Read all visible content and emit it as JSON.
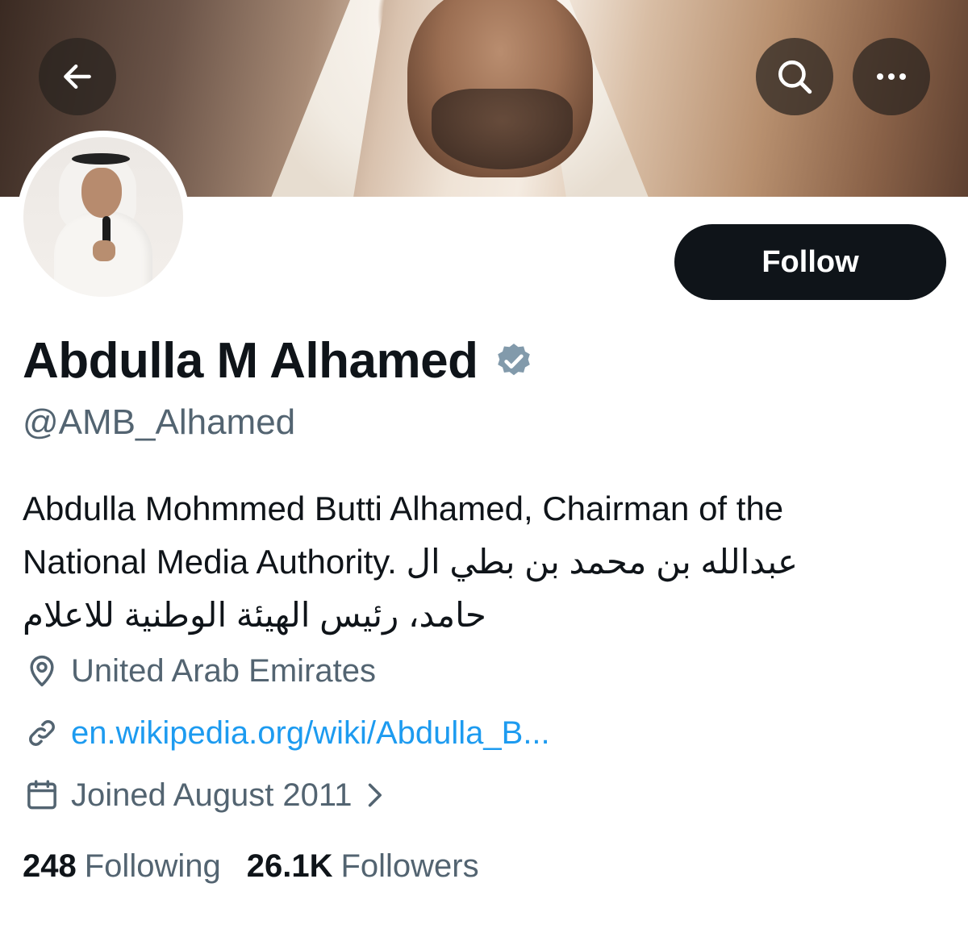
{
  "header": {
    "back_icon": "arrow-left-icon",
    "search_icon": "search-icon",
    "more_icon": "more-horizontal-icon"
  },
  "profile": {
    "display_name": "Abdulla M Alhamed",
    "verified_icon": "verified-badge-icon",
    "verified_color": "#829aab",
    "handle": "@AMB_Alhamed",
    "bio_lines": [
      "Abdulla Mohmmed Butti Alhamed, Chairman of the",
      "National Media Authority. عبدالله بن محمد بن بطي ال",
      "حامد، رئيس الهيئة الوطنية للاعلام"
    ],
    "location": "United Arab Emirates",
    "link": "en.wikipedia.org/wiki/Abdulla_B...",
    "joined": "Joined August 2011",
    "following_count": "248",
    "following_label": "Following",
    "followers_count": "26.1K",
    "followers_label": "Followers"
  },
  "actions": {
    "follow_label": "Follow"
  },
  "colors": {
    "follow_bg": "#0f1419",
    "link": "#1d9bf0",
    "secondary_text": "#536471"
  }
}
